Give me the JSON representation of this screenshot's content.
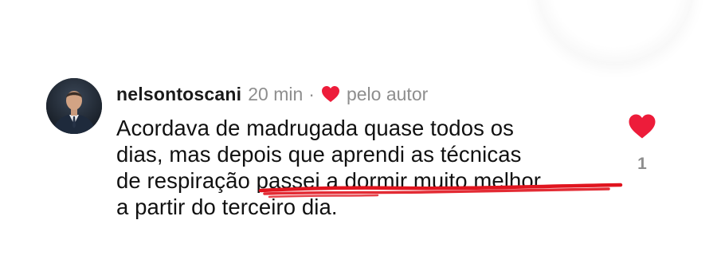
{
  "comment": {
    "username": "nelsontoscani",
    "time": "20 min",
    "separator": "·",
    "liked_by_author_label": "pelo autor",
    "text_lines": [
      "Acordava de madrugada quase todos os",
      "dias, mas depois que aprendi as técnicas",
      "de respiração passei a dormir muito melhor",
      "a partir do terceiro dia."
    ],
    "like_count": "1"
  },
  "icons": {
    "author_like": "heart-icon",
    "like_button": "heart-icon"
  },
  "colors": {
    "heart": "#ed1c3a",
    "underline": "#e0141e",
    "meta_gray": "#8e8e8e",
    "text": "#111111"
  }
}
